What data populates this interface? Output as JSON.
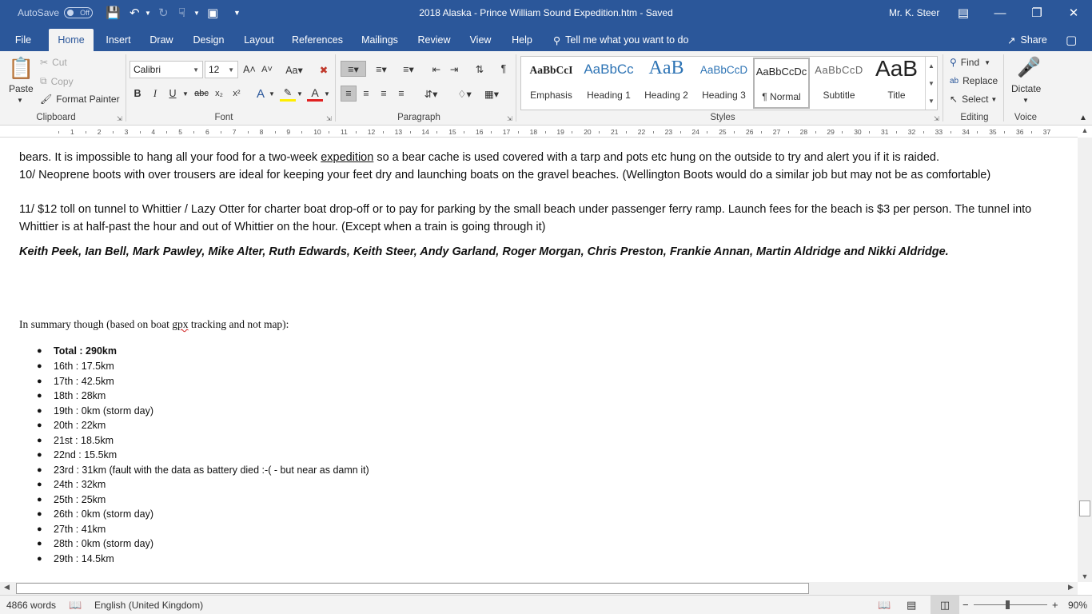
{
  "titlebar": {
    "autosave_label": "AutoSave",
    "autosave_state": "Off",
    "doc_title": "2018 Alaska - Prince William Sound Expedition.htm  -  Saved",
    "user": "Mr. K. Steer"
  },
  "tabs": [
    "File",
    "Home",
    "Insert",
    "Draw",
    "Design",
    "Layout",
    "References",
    "Mailings",
    "Review",
    "View",
    "Help"
  ],
  "active_tab": "Home",
  "tell_me": "Tell me what you want to do",
  "share_label": "Share",
  "clipboard": {
    "paste": "Paste",
    "cut": "Cut",
    "copy": "Copy",
    "format_painter": "Format Painter",
    "label": "Clipboard"
  },
  "font": {
    "name": "Calibri",
    "size": "12",
    "label": "Font"
  },
  "paragraph": {
    "label": "Paragraph"
  },
  "styles": {
    "label": "Styles",
    "items": [
      {
        "sample": "AaBbCcI",
        "name": "Emphasis"
      },
      {
        "sample": "AaBbCc",
        "name": "Heading 1"
      },
      {
        "sample": "AaB",
        "name": "Heading 2"
      },
      {
        "sample": "AaBbCcD",
        "name": "Heading 3"
      },
      {
        "sample": "AaBbCcDc",
        "name": "¶ Normal"
      },
      {
        "sample": "AaBbCcD",
        "name": "Subtitle"
      },
      {
        "sample": "AaB",
        "name": "Title"
      }
    ]
  },
  "editing": {
    "find": "Find",
    "replace": "Replace",
    "select": "Select",
    "label": "Editing"
  },
  "voice": {
    "dictate": "Dictate",
    "label": "Voice"
  },
  "ruler_numbers": [
    "1",
    "2",
    "3",
    "4",
    "5",
    "6",
    "7",
    "8",
    "9",
    "10",
    "11",
    "12",
    "13",
    "14",
    "15",
    "16",
    "17",
    "18",
    "19",
    "20",
    "21",
    "22",
    "23",
    "24",
    "25",
    "26",
    "27",
    "28",
    "29",
    "30",
    "31",
    "32",
    "33",
    "34",
    "35",
    "36",
    "37"
  ],
  "document": {
    "line_top_a": "bears. It is impossible to hang all your food for a two-week ",
    "line_top_link": "expedition",
    "line_top_b": " so a bear cache is used covered with a tarp and pots etc hung on the outside to try and alert you if it is raided.",
    "item10": "10/ Neoprene boots with over trousers are ideal for keeping your feet dry and launching boats on the gravel beaches. (Wellington Boots would do a similar job but may not be as comfortable)",
    "item11": "11/ $12 toll on tunnel to Whittier / Lazy Otter for charter boat drop-off or to pay for parking by the small beach under passenger ferry ramp.  Launch fees for the beach is $3 per person.  The tunnel into Whittier is at half-past the hour and out of Whittier on the hour.  (Except when a train is going through it)",
    "authors": "Keith Peek, Ian Bell, Mark Pawley, Mike Alter, Ruth Edwards, Keith Steer, Andy Garland, Roger Morgan, Chris Preston, Frankie Annan, Martin Aldridge and Nikki Aldridge.",
    "summary_intro_a": "In summary though (based on boat ",
    "summary_intro_err": "gpx",
    "summary_intro_b": " tracking and not map):",
    "summary": [
      "Total : 290km",
      "16th : 17.5km",
      "17th : 42.5km",
      "18th : 28km",
      "19th : 0km (storm day)",
      "20th : 22km",
      "21st : 18.5km",
      "22nd : 15.5km",
      "23rd : 31km (fault with the data as battery died :-( - but near as damn it)",
      "24th : 32km",
      "25th : 25km",
      "26th : 0km (storm day)",
      "27th : 41km",
      "28th : 0km (storm day)",
      "29th : 14.5km"
    ]
  },
  "statusbar": {
    "words": "4866 words",
    "language": "English (United Kingdom)",
    "zoom": "90%"
  },
  "colors": {
    "brand": "#2b579a",
    "ribbon": "#f3f3f3"
  }
}
